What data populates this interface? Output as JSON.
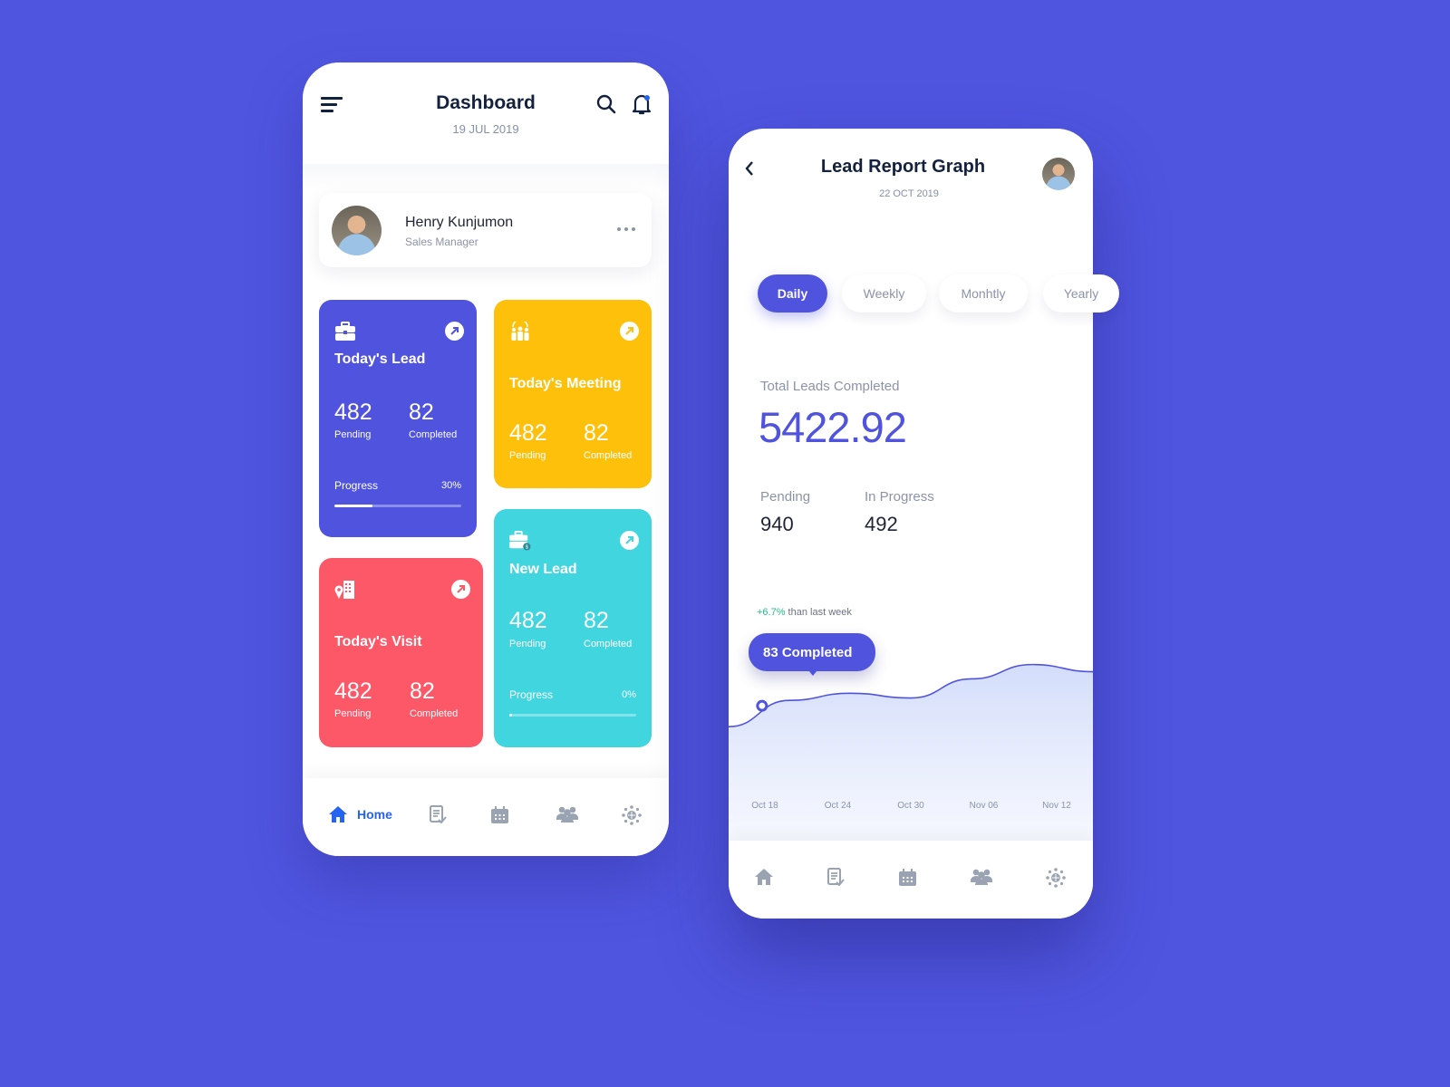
{
  "dashboard": {
    "title": "Dashboard",
    "date": "19 JUL 2019",
    "profile": {
      "name": "Henry Kunjumon",
      "role": "Sales Manager"
    },
    "cards": [
      {
        "id": "lead",
        "title": "Today's Lead",
        "icon": "briefcase-icon",
        "color": "#4F53DE",
        "pending": "482",
        "pending_label": "Pending",
        "completed": "82",
        "completed_label": "Completed",
        "progress_label": "Progress",
        "progress_text": "30%",
        "progress": 0.3
      },
      {
        "id": "meeting",
        "title": "Today's Meeting",
        "icon": "meeting-people-icon",
        "color": "#FEC00B",
        "pending": "482",
        "pending_label": "Pending",
        "completed": "82",
        "completed_label": "Completed"
      },
      {
        "id": "visit",
        "title": "Today's Visit",
        "icon": "building-location-icon",
        "color": "#FD5868",
        "pending": "482",
        "pending_label": "Pending",
        "completed": "82",
        "completed_label": "Completed"
      },
      {
        "id": "newlead",
        "title": "New Lead",
        "icon": "briefcase-dollar-icon",
        "color": "#41D5E0",
        "pending": "482",
        "pending_label": "Pending",
        "completed": "82",
        "completed_label": "Completed",
        "progress_label": "Progress",
        "progress_text": "0%",
        "progress": 0.0
      }
    ],
    "nav": [
      {
        "label": "Home",
        "icon": "home-icon",
        "active": true
      },
      {
        "label": "",
        "icon": "report-icon",
        "active": false
      },
      {
        "label": "",
        "icon": "calendar-icon",
        "active": false
      },
      {
        "label": "",
        "icon": "team-icon",
        "active": false
      },
      {
        "label": "",
        "icon": "network-icon",
        "active": false
      }
    ]
  },
  "report": {
    "title": "Lead Report Graph",
    "date": "22 OCT 2019",
    "tabs": [
      {
        "label": "Daily",
        "active": true
      },
      {
        "label": "Weekly",
        "active": false
      },
      {
        "label": "Monhtly",
        "active": false
      },
      {
        "label": "Yearly",
        "active": false
      }
    ],
    "total_label": "Total Leads Completed",
    "total_value": "5422.92",
    "stats": [
      {
        "label": "Pending",
        "value": "940"
      },
      {
        "label": "In Progress",
        "value": "492"
      }
    ],
    "change_value": "+6.7%",
    "change_text": " than last week",
    "tooltip": "83 Completed",
    "colors": {
      "accent": "#4F53DE",
      "positive": "#1DBF84"
    }
  },
  "chart_data": {
    "type": "area",
    "x": [
      "Oct 18",
      "Oct 24",
      "Oct 30",
      "Nov 06",
      "Nov 12"
    ],
    "series": [
      {
        "name": "Completed",
        "values": [
          72,
          83,
          86,
          84,
          92,
          98,
          95
        ]
      }
    ],
    "highlight": {
      "label": "83 Completed",
      "value": 83
    },
    "ylim": [
      0,
      110
    ],
    "grid": false,
    "title": "",
    "xlabel": "",
    "ylabel": ""
  }
}
